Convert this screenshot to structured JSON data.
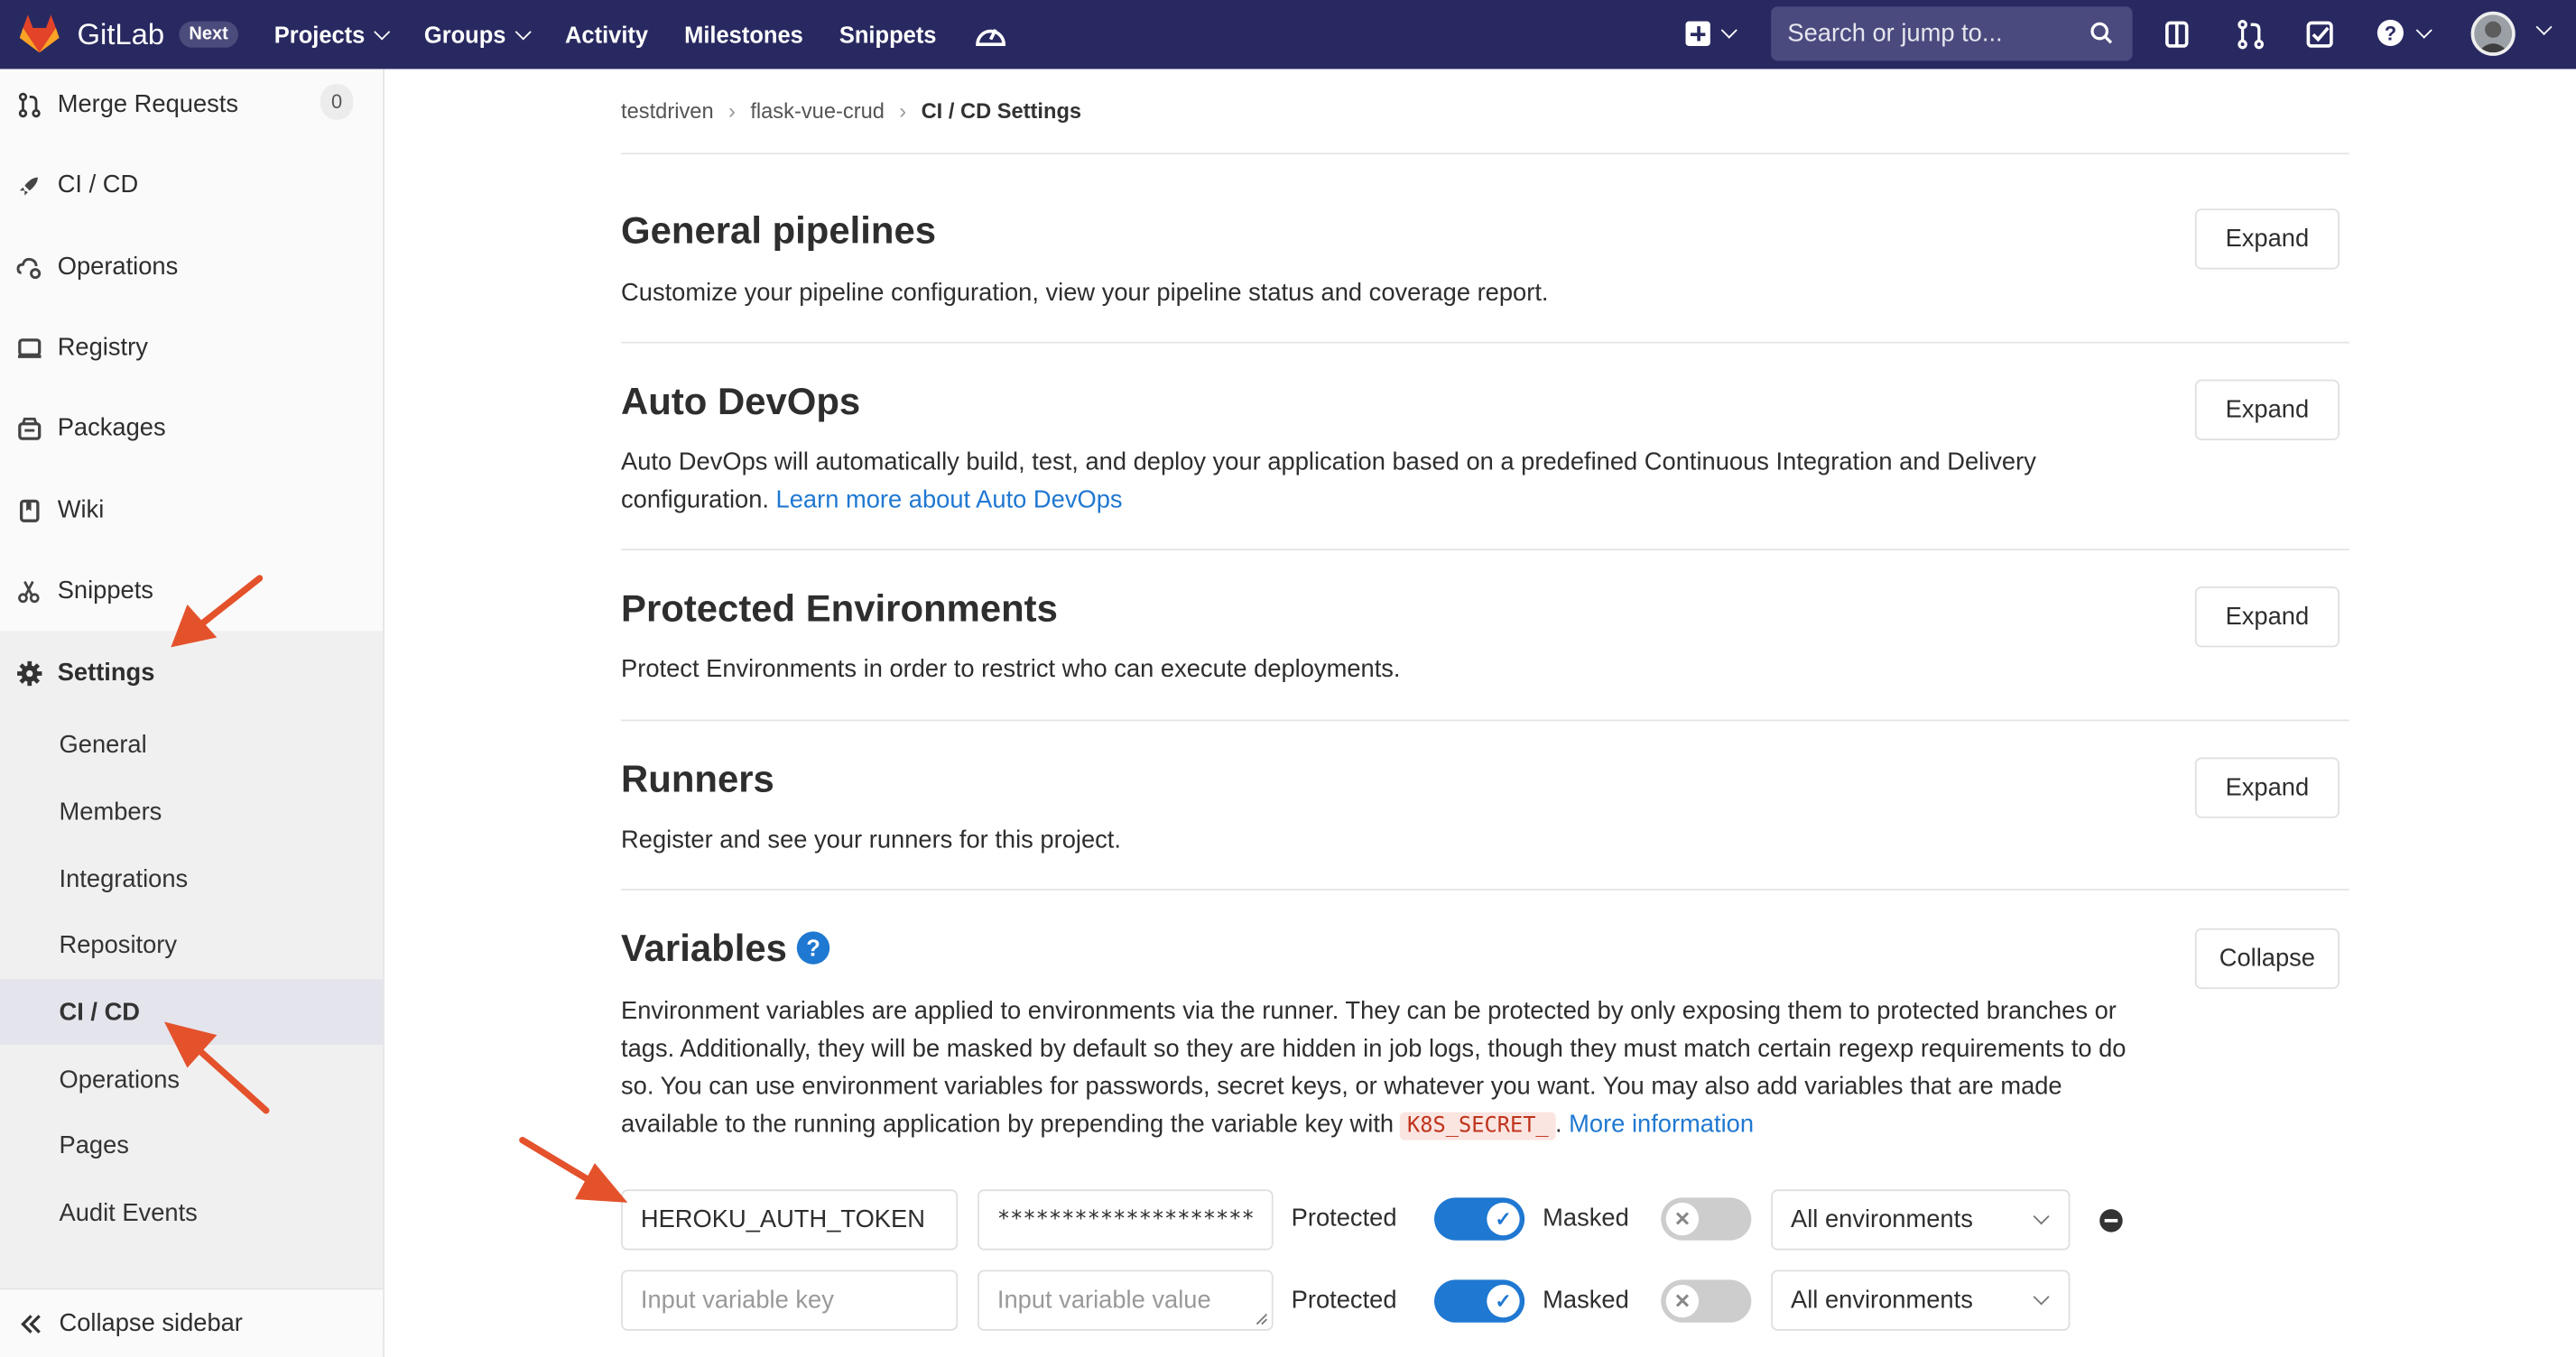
{
  "topnav": {
    "brand": "GitLab",
    "badge": "Next",
    "links": [
      "Projects",
      "Groups",
      "Activity",
      "Milestones",
      "Snippets"
    ],
    "search_placeholder": "Search or jump to...",
    "colors": {
      "bar": "#292961",
      "logo": "#e24329"
    }
  },
  "sidebar": {
    "items": [
      {
        "label": "Merge Requests",
        "icon": "merge-request-icon",
        "count": "0"
      },
      {
        "label": "CI / CD",
        "icon": "rocket-icon"
      },
      {
        "label": "Operations",
        "icon": "cloud-gear-icon"
      },
      {
        "label": "Registry",
        "icon": "container-icon"
      },
      {
        "label": "Packages",
        "icon": "package-icon"
      },
      {
        "label": "Wiki",
        "icon": "book-icon"
      },
      {
        "label": "Snippets",
        "icon": "scissors-icon"
      },
      {
        "label": "Settings",
        "icon": "gear-icon"
      }
    ],
    "settings_sub": [
      "General",
      "Members",
      "Integrations",
      "Repository",
      "CI / CD",
      "Operations",
      "Pages",
      "Audit Events"
    ],
    "active_sub": "CI / CD",
    "collapse_label": "Collapse sidebar"
  },
  "breadcrumb": [
    "testdriven",
    "flask-vue-crud",
    "CI / CD Settings"
  ],
  "sections": [
    {
      "title": "General pipelines",
      "desc": "Customize your pipeline configuration, view your pipeline status and coverage report.",
      "button": "Expand"
    },
    {
      "title": "Auto DevOps",
      "desc": "Auto DevOps will automatically build, test, and deploy your application based on a predefined Continuous Integration and Delivery configuration.",
      "link": "Learn more about Auto DevOps",
      "button": "Expand"
    },
    {
      "title": "Protected Environments",
      "desc": "Protect Environments in order to restrict who can execute deployments.",
      "button": "Expand"
    },
    {
      "title": "Runners",
      "desc": "Register and see your runners for this project.",
      "button": "Expand"
    },
    {
      "title": "Variables",
      "desc_before": "Environment variables are applied to environments via the runner. They can be protected by only exposing them to protected branches or tags. Additionally, they will be masked by default so they are hidden in job logs, though they must match certain regexp requirements to do so. You can use environment variables for passwords, secret keys, or whatever you want. You may also add variables that are made available to the running application by prepending the variable key with",
      "code": "K8S_SECRET_",
      "link": "More information",
      "button": "Collapse"
    }
  ],
  "variables": {
    "rows": [
      {
        "key": "HEROKU_AUTH_TOKEN",
        "value": "********************",
        "protected": true,
        "masked": false,
        "environment": "All environments"
      },
      {
        "key_placeholder": "Input variable key",
        "value_placeholder": "Input variable value",
        "protected": true,
        "masked": false,
        "environment": "All environments"
      }
    ],
    "protected_label": "Protected",
    "masked_label": "Masked"
  },
  "annotation_color": "#e4522c"
}
